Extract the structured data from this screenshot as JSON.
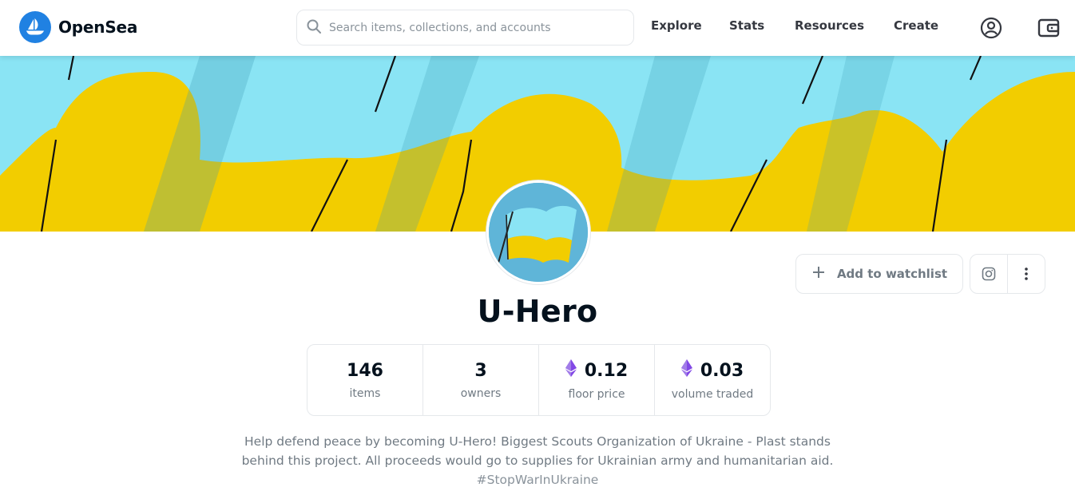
{
  "brand": {
    "name": "OpenSea",
    "color": "#2081e2"
  },
  "search": {
    "placeholder": "Search items, collections, and accounts",
    "value": ""
  },
  "nav": {
    "links": [
      {
        "label": "Explore"
      },
      {
        "label": "Stats"
      },
      {
        "label": "Resources"
      },
      {
        "label": "Create"
      }
    ],
    "icons": [
      "account-icon",
      "wallet-icon"
    ]
  },
  "banner": {
    "colors": {
      "sky": "#8ae4f4",
      "flag": "#f2cd00"
    }
  },
  "collection": {
    "name": "U-Hero",
    "watchlist_label": "Add to watchlist",
    "stats": [
      {
        "value": "146",
        "label": "items",
        "eth": false
      },
      {
        "value": "3",
        "label": "owners",
        "eth": false
      },
      {
        "value": "0.12",
        "label": "floor price",
        "eth": true
      },
      {
        "value": "0.03",
        "label": "volume traded",
        "eth": true
      }
    ],
    "description_line1": "Help defend peace by becoming U-Hero! Biggest Scouts Organization of Ukraine - Plast stands",
    "description_line2": "behind this project. All proceeds would go to supplies for Ukrainian army and humanitarian aid.",
    "hashtag": "#StopWarInUkraine"
  }
}
